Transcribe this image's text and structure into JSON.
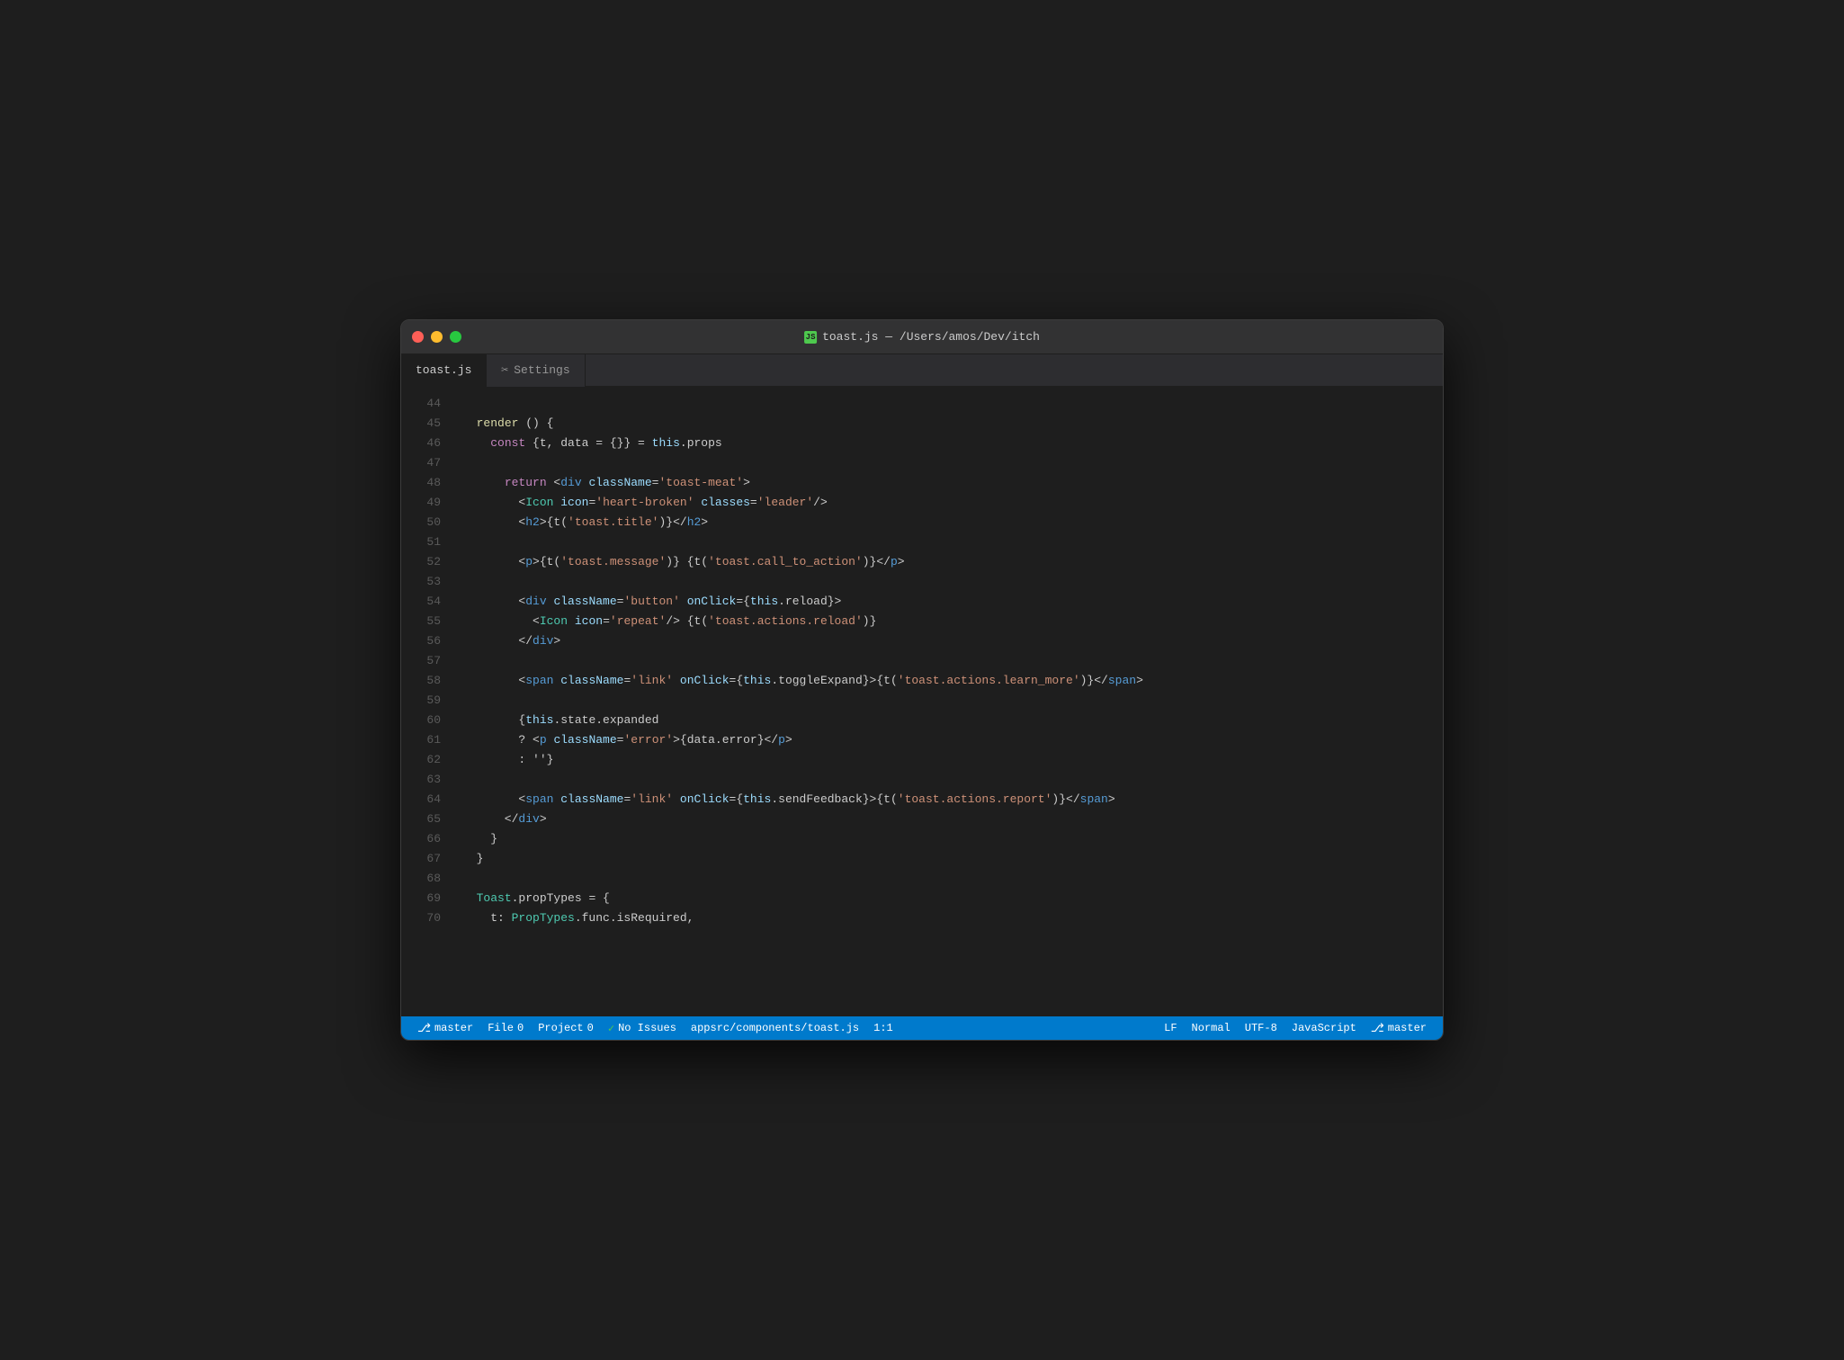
{
  "window": {
    "title": "toast.js — /Users/amos/Dev/itch",
    "title_icon": "JS"
  },
  "tabs": [
    {
      "label": "toast.js",
      "active": true
    },
    {
      "label": "Settings",
      "active": false,
      "icon": "✂"
    }
  ],
  "statusbar": {
    "file_label": "File",
    "file_count": "0",
    "project_label": "Project",
    "project_count": "0",
    "issues_icon": "✓",
    "issues_label": "No Issues",
    "filepath": "appsrc/components/toast.js",
    "cursor": "1:1",
    "line_ending": "LF",
    "indent_mode": "Normal",
    "encoding": "UTF-8",
    "language": "JavaScript",
    "git_branch": "master"
  },
  "lines": [
    {
      "num": "44",
      "code": ""
    },
    {
      "num": "45",
      "tokens": [
        {
          "t": "plain",
          "v": "  "
        },
        {
          "t": "render-kw",
          "v": "render"
        },
        {
          "t": "plain",
          "v": " () {"
        }
      ]
    },
    {
      "num": "46",
      "tokens": [
        {
          "t": "plain",
          "v": "    "
        },
        {
          "t": "kw",
          "v": "const"
        },
        {
          "t": "plain",
          "v": " {t, data = {}} = "
        },
        {
          "t": "this-kw",
          "v": "this"
        },
        {
          "t": "plain",
          "v": ".props"
        }
      ]
    },
    {
      "num": "47",
      "code": ""
    },
    {
      "num": "48",
      "tokens": [
        {
          "t": "plain",
          "v": "      "
        },
        {
          "t": "kw",
          "v": "return"
        },
        {
          "t": "plain",
          "v": " <"
        },
        {
          "t": "tag-html",
          "v": "div"
        },
        {
          "t": "plain",
          "v": " "
        },
        {
          "t": "attr",
          "v": "className"
        },
        {
          "t": "plain",
          "v": "="
        },
        {
          "t": "str",
          "v": "'toast-meat'"
        },
        {
          "t": "plain",
          "v": ">"
        }
      ]
    },
    {
      "num": "49",
      "tokens": [
        {
          "t": "plain",
          "v": "        <"
        },
        {
          "t": "tag-name",
          "v": "Icon"
        },
        {
          "t": "plain",
          "v": " "
        },
        {
          "t": "attr",
          "v": "icon"
        },
        {
          "t": "plain",
          "v": "="
        },
        {
          "t": "str",
          "v": "'heart-broken'"
        },
        {
          "t": "plain",
          "v": " "
        },
        {
          "t": "attr",
          "v": "classes"
        },
        {
          "t": "plain",
          "v": "="
        },
        {
          "t": "str",
          "v": "'leader'"
        },
        {
          "t": "plain",
          "v": "/>"
        }
      ]
    },
    {
      "num": "50",
      "tokens": [
        {
          "t": "plain",
          "v": "        <"
        },
        {
          "t": "tag-html",
          "v": "h2"
        },
        {
          "t": "plain",
          "v": ">{t("
        },
        {
          "t": "str",
          "v": "'toast.title'"
        },
        {
          "t": "plain",
          "v": ")}</"
        },
        {
          "t": "tag-html",
          "v": "h2"
        },
        {
          "t": "plain",
          "v": ">"
        }
      ]
    },
    {
      "num": "51",
      "code": ""
    },
    {
      "num": "52",
      "tokens": [
        {
          "t": "plain",
          "v": "        <"
        },
        {
          "t": "tag-html",
          "v": "p"
        },
        {
          "t": "plain",
          "v": ">{t("
        },
        {
          "t": "str",
          "v": "'toast.message'"
        },
        {
          "t": "plain",
          "v": ")} {t("
        },
        {
          "t": "str",
          "v": "'toast.call_to_action'"
        },
        {
          "t": "plain",
          "v": ")}</"
        },
        {
          "t": "tag-html",
          "v": "p"
        },
        {
          "t": "plain",
          "v": ">"
        }
      ]
    },
    {
      "num": "53",
      "code": ""
    },
    {
      "num": "54",
      "tokens": [
        {
          "t": "plain",
          "v": "        <"
        },
        {
          "t": "tag-html",
          "v": "div"
        },
        {
          "t": "plain",
          "v": " "
        },
        {
          "t": "attr",
          "v": "className"
        },
        {
          "t": "plain",
          "v": "="
        },
        {
          "t": "str",
          "v": "'button'"
        },
        {
          "t": "plain",
          "v": " "
        },
        {
          "t": "attr",
          "v": "onClick"
        },
        {
          "t": "plain",
          "v": "={"
        },
        {
          "t": "this-kw",
          "v": "this"
        },
        {
          "t": "plain",
          "v": ".reload}>"
        }
      ]
    },
    {
      "num": "55",
      "tokens": [
        {
          "t": "plain",
          "v": "          <"
        },
        {
          "t": "tag-name",
          "v": "Icon"
        },
        {
          "t": "plain",
          "v": " "
        },
        {
          "t": "attr",
          "v": "icon"
        },
        {
          "t": "plain",
          "v": "="
        },
        {
          "t": "str",
          "v": "'repeat'"
        },
        {
          "t": "plain",
          "v": "/> {t("
        },
        {
          "t": "str",
          "v": "'toast.actions.reload'"
        },
        {
          "t": "plain",
          "v": ")}"
        }
      ]
    },
    {
      "num": "56",
      "tokens": [
        {
          "t": "plain",
          "v": "        </"
        },
        {
          "t": "tag-html",
          "v": "div"
        },
        {
          "t": "plain",
          "v": ">"
        }
      ]
    },
    {
      "num": "57",
      "code": ""
    },
    {
      "num": "58",
      "tokens": [
        {
          "t": "plain",
          "v": "        <"
        },
        {
          "t": "tag-html",
          "v": "span"
        },
        {
          "t": "plain",
          "v": " "
        },
        {
          "t": "attr",
          "v": "className"
        },
        {
          "t": "plain",
          "v": "="
        },
        {
          "t": "str",
          "v": "'link'"
        },
        {
          "t": "plain",
          "v": " "
        },
        {
          "t": "attr",
          "v": "onClick"
        },
        {
          "t": "plain",
          "v": "={"
        },
        {
          "t": "this-kw",
          "v": "this"
        },
        {
          "t": "plain",
          "v": ".toggleExpand}>{t("
        },
        {
          "t": "str",
          "v": "'toast.actions.learn_more'"
        },
        {
          "t": "plain",
          "v": ")}</"
        },
        {
          "t": "tag-html",
          "v": "span"
        },
        {
          "t": "plain",
          "v": ">"
        }
      ]
    },
    {
      "num": "59",
      "code": ""
    },
    {
      "num": "60",
      "tokens": [
        {
          "t": "plain",
          "v": "        {"
        },
        {
          "t": "this-kw",
          "v": "this"
        },
        {
          "t": "plain",
          "v": ".state.expanded"
        }
      ]
    },
    {
      "num": "61",
      "tokens": [
        {
          "t": "plain",
          "v": "        ? <"
        },
        {
          "t": "tag-html",
          "v": "p"
        },
        {
          "t": "plain",
          "v": " "
        },
        {
          "t": "attr",
          "v": "className"
        },
        {
          "t": "plain",
          "v": "="
        },
        {
          "t": "str",
          "v": "'error'"
        },
        {
          "t": "plain",
          "v": ">{data.error}</"
        },
        {
          "t": "tag-html",
          "v": "p"
        },
        {
          "t": "plain",
          "v": ">"
        }
      ]
    },
    {
      "num": "62",
      "tokens": [
        {
          "t": "plain",
          "v": "        : ''}"
        }
      ]
    },
    {
      "num": "63",
      "code": ""
    },
    {
      "num": "64",
      "tokens": [
        {
          "t": "plain",
          "v": "        <"
        },
        {
          "t": "tag-html",
          "v": "span"
        },
        {
          "t": "plain",
          "v": " "
        },
        {
          "t": "attr",
          "v": "className"
        },
        {
          "t": "plain",
          "v": "="
        },
        {
          "t": "str",
          "v": "'link'"
        },
        {
          "t": "plain",
          "v": " "
        },
        {
          "t": "attr",
          "v": "onClick"
        },
        {
          "t": "plain",
          "v": "={"
        },
        {
          "t": "this-kw",
          "v": "this"
        },
        {
          "t": "plain",
          "v": ".sendFeedback}>{t("
        },
        {
          "t": "str",
          "v": "'toast.actions.report'"
        },
        {
          "t": "plain",
          "v": ")}</"
        },
        {
          "t": "tag-html",
          "v": "span"
        },
        {
          "t": "plain",
          "v": ">"
        }
      ]
    },
    {
      "num": "65",
      "tokens": [
        {
          "t": "plain",
          "v": "      </"
        },
        {
          "t": "tag-html",
          "v": "div"
        },
        {
          "t": "plain",
          "v": ">"
        }
      ]
    },
    {
      "num": "66",
      "tokens": [
        {
          "t": "plain",
          "v": "    }"
        }
      ]
    },
    {
      "num": "67",
      "tokens": [
        {
          "t": "plain",
          "v": "  }"
        }
      ]
    },
    {
      "num": "68",
      "code": ""
    },
    {
      "num": "69",
      "tokens": [
        {
          "t": "plain",
          "v": "  "
        },
        {
          "t": "class-name",
          "v": "Toast"
        },
        {
          "t": "plain",
          "v": ".propTypes = {"
        }
      ]
    },
    {
      "num": "70",
      "tokens": [
        {
          "t": "plain",
          "v": "    t: "
        },
        {
          "t": "class-name",
          "v": "PropTypes"
        },
        {
          "t": "plain",
          "v": ".func.isRequired,"
        }
      ]
    }
  ]
}
